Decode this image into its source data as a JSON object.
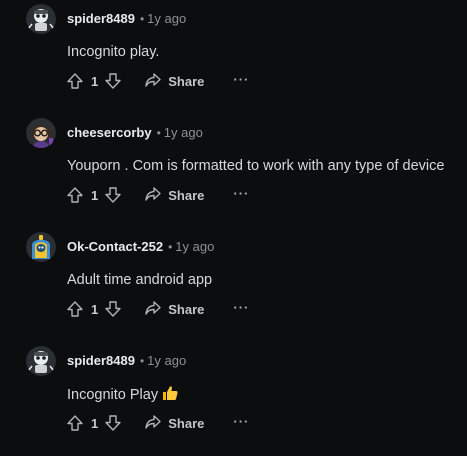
{
  "comments": [
    {
      "username": "spider8489",
      "separator": "•",
      "time": "1y ago",
      "text": "Incognito play.",
      "score": "1",
      "share_label": "Share",
      "more_label": "···",
      "avatar": "robot-spider-avatar"
    },
    {
      "username": "cheesercorby",
      "separator": "•",
      "time": "1y ago",
      "text": "Youporn . Com is formatted to work with any type of device",
      "score": "1",
      "share_label": "Share",
      "more_label": "···",
      "avatar": "glasses-avatar"
    },
    {
      "username": "Ok-Contact-252",
      "separator": "•",
      "time": "1y ago",
      "text": "Adult time android app",
      "score": "1",
      "share_label": "Share",
      "more_label": "···",
      "avatar": "yellow-hooded-avatar"
    },
    {
      "username": "spider8489",
      "separator": "•",
      "time": "1y ago",
      "text": "Incognito Play",
      "emoji": "thumbs-up-emoji",
      "score": "1",
      "share_label": "Share",
      "more_label": "···",
      "avatar": "robot-spider-avatar"
    }
  ],
  "colors": {
    "background": "#0b0d0e",
    "text": "#d7dadc",
    "muted": "#8d9296",
    "accent_yellow": "#f4c430",
    "accent_blue": "#3a8fd6"
  }
}
